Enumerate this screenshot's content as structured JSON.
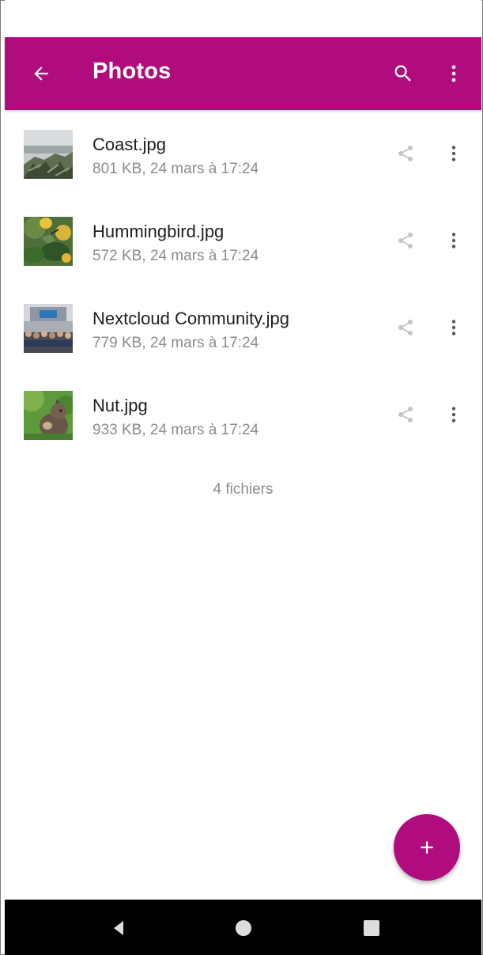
{
  "app": {
    "title": "Photos",
    "accent_color": "#b10c7d"
  },
  "toolbar": {
    "back_icon": "arrow-back-icon",
    "search_icon": "search-icon",
    "overflow_icon": "more-vertical-icon"
  },
  "files": [
    {
      "name": "Coast.jpg",
      "meta": "801 KB, 24 mars à 17:24",
      "thumbnail": "coast-thumbnail"
    },
    {
      "name": "Hummingbird.jpg",
      "meta": "572 KB, 24 mars à 17:24",
      "thumbnail": "hummingbird-thumbnail"
    },
    {
      "name": "Nextcloud Community.jpg",
      "meta": "779 KB, 24 mars à 17:24",
      "thumbnail": "community-thumbnail"
    },
    {
      "name": "Nut.jpg",
      "meta": "933 KB, 24 mars à 17:24",
      "thumbnail": "squirrel-thumbnail"
    }
  ],
  "footer": {
    "file_count": "4 fichiers"
  },
  "fab": {
    "icon": "plus-icon"
  },
  "system_nav": {
    "back": "nav-back-icon",
    "home": "nav-home-icon",
    "recents": "nav-recents-icon"
  }
}
